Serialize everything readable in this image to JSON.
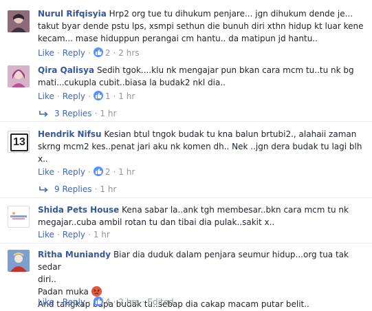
{
  "comments": [
    {
      "author": "Nurul Rifqisyia",
      "lines": [
        "Hrp2 org tue tu dihukum penjare... jgn dihukum dende je...",
        "takut byar dende pstu lps, xsmpi sethun die bunuh diri xthn hidup kt luar kene",
        "kecam... mase hiduppun perangai cm hantu.. da matipun jd hantu.."
      ],
      "like_label": "Like",
      "reply_label": "Reply",
      "reaction_count": "2",
      "time": "2 hrs"
    },
    {
      "author": "Qira Qalisya",
      "lines": [
        "Sedih tgok....klu nk mengajar pun bkan cara mcm tu..tu nk bg",
        "mati...cukupla cubit..biasa la budak2 nkl dia.."
      ],
      "like_label": "Like",
      "reply_label": "Reply",
      "reaction_count": "1",
      "time": "1 hr",
      "replies_label": "3 Replies",
      "replies_time": "1 hr"
    },
    {
      "author": "Hendrik Nifsu",
      "avatar_text": "13",
      "lines": [
        "Kesian btul tngok budak tu kna balun brtubi2., alahaii zaman",
        "skrng mcm2 kes..penat jari aku nk komen dh.. Nek ..jgn dera budak tu lagi blh",
        "x.."
      ],
      "like_label": "Like",
      "reply_label": "Reply",
      "reaction_count": "2",
      "time": "1 hr",
      "replies_label": "9 Replies",
      "replies_time": "1 hr"
    },
    {
      "author": "Shida Pets House",
      "lines": [
        "Kena sabar la..ank tgh membesar..bkn cara mcm tu nk",
        "megajar..cuba ambil rotan tu dan tibai dia pulak..sakit x.."
      ],
      "like_label": "Like",
      "reply_label": "Reply",
      "time": "1 hr"
    },
    {
      "author": "Ritha Muniandy",
      "lines": [
        "Biar dia duduk dalam penjara seumur hidup...org tua tak sedar",
        "diri..",
        "Padan muka",
        "And tangkap bapa budak tu..sebap dia cakap macam putar belit.."
      ],
      "like_label": "Like",
      "reply_label": "Reply",
      "reaction_count": "4",
      "time": "2 hrs",
      "edited_label": "Edited"
    }
  ],
  "colors": {
    "name": "#365899",
    "link": "#4267b2",
    "meta": "#90949c",
    "like_badge": "#5890ff",
    "angry": "#e8573d"
  },
  "icons": {
    "like": "thumbs-up-icon",
    "reply": "reply-arrow-icon",
    "emoji": "angry-face-emoji"
  }
}
